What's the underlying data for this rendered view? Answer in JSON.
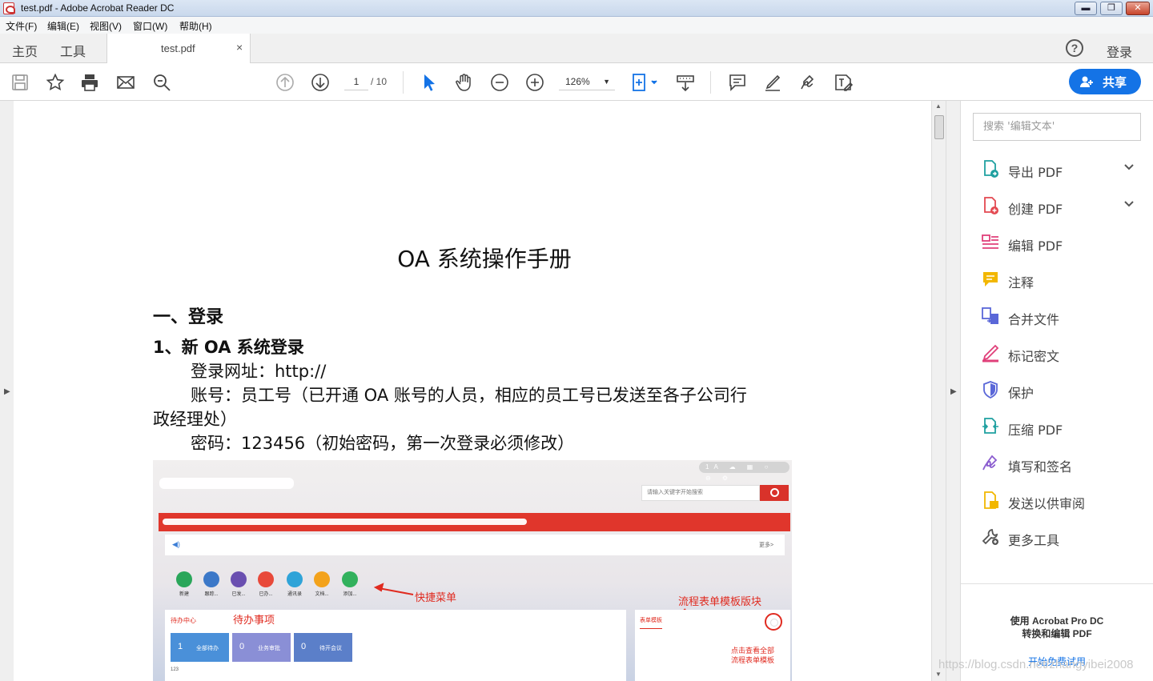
{
  "window": {
    "title": "test.pdf - Adobe Acrobat Reader DC",
    "minimize": "▬",
    "restore": "❐",
    "close": "✕"
  },
  "menubar": [
    "文件(F)",
    "编辑(E)",
    "视图(V)",
    "窗口(W)",
    "帮助(H)"
  ],
  "tabs": {
    "home": "主页",
    "tools": "工具",
    "document": "test.pdf",
    "close": "×",
    "help": "?",
    "login": "登录"
  },
  "toolbar": {
    "current_page": "1",
    "total_pages": "/ 10",
    "zoom": "126%",
    "zoom_dropdown": "▼",
    "share": "共享",
    "left_icons": [
      "save-icon",
      "bookmark-star-icon",
      "print-icon",
      "email-icon",
      "search-zoom-icon"
    ],
    "nav_icons": [
      "page-up-icon",
      "page-down-icon"
    ],
    "tool_icons": [
      "select-arrow-icon",
      "hand-icon",
      "zoom-out-icon",
      "zoom-in-icon",
      "fit-page-icon",
      "scroll-mode-icon",
      "comment-icon",
      "highlight-icon",
      "sign-icon",
      "edit-text-icon"
    ]
  },
  "document": {
    "title": "OA 系统操作手册",
    "heading1": "一、登录",
    "heading2": "1、新 OA 系统登录",
    "lines": [
      "登录网址：http://",
      "账号：员工号（已开通 OA 账号的人员，相应的员工号已发送至各子公司行",
      "政经理处）",
      "密码：123456（初始密码，第一次登录必须修改）"
    ],
    "screenshot": {
      "search_placeholder": "请输入关键字开始搜索",
      "top_icons": "1A ☁ ▦ ○ ⊖ ⚙",
      "notice_more": "更多>",
      "quick_menu": [
        {
          "label": "新建",
          "color": "#2aa65a"
        },
        {
          "label": "跟踪...",
          "color": "#3c78c8"
        },
        {
          "label": "已发...",
          "color": "#6a4fb0"
        },
        {
          "label": "已办...",
          "color": "#e8493a"
        },
        {
          "label": "通讯录",
          "color": "#2fa3d8"
        },
        {
          "label": "文档...",
          "color": "#f3a21c"
        },
        {
          "label": "添加...",
          "color": "#32b15d"
        }
      ],
      "annotations": {
        "quick_menu": "快捷菜单",
        "form_templates": "流程表单模板版块",
        "todo": "待办事项",
        "view_all_line1": "点击查看全部",
        "view_all_line2": "流程表单模板"
      },
      "todo_title": "待办中心",
      "template_title": "表单模板",
      "tiles": [
        {
          "count": "1",
          "label": "全部待办",
          "color": "#4a90d9"
        },
        {
          "count": "0",
          "label": "业务审批",
          "color": "#8a8fd6"
        },
        {
          "count": "0",
          "label": "待开会议",
          "color": "#5b7fc9"
        }
      ],
      "footer_number": "123"
    }
  },
  "right_panel": {
    "search_placeholder": "搜索 '编辑文本'",
    "tools": [
      {
        "label": "导出 PDF",
        "icon": "export-pdf-icon",
        "color": "#1fa0a0",
        "expandable": true
      },
      {
        "label": "创建 PDF",
        "icon": "create-pdf-icon",
        "color": "#e34850",
        "expandable": true
      },
      {
        "label": "编辑 PDF",
        "icon": "edit-pdf-icon",
        "color": "#e0407a",
        "expandable": false
      },
      {
        "label": "注释",
        "icon": "comment-icon",
        "color": "#f2b700",
        "expandable": false
      },
      {
        "label": "合并文件",
        "icon": "combine-files-icon",
        "color": "#5a67d8",
        "expandable": false
      },
      {
        "label": "标记密文",
        "icon": "redact-icon",
        "color": "#e0407a",
        "expandable": false
      },
      {
        "label": "保护",
        "icon": "protect-icon",
        "color": "#5a67d8",
        "expandable": false
      },
      {
        "label": "压缩 PDF",
        "icon": "compress-pdf-icon",
        "color": "#1fa0a0",
        "expandable": false
      },
      {
        "label": "填写和签名",
        "icon": "fill-sign-icon",
        "color": "#8a5ccf",
        "expandable": false
      },
      {
        "label": "发送以供审阅",
        "icon": "send-review-icon",
        "color": "#f2b700",
        "expandable": false
      },
      {
        "label": "更多工具",
        "icon": "more-tools-icon",
        "color": "#555555",
        "expandable": false
      }
    ],
    "promo_line1": "使用 Acrobat Pro DC",
    "promo_line2": "转换和编辑 PDF",
    "promo_trial": "开始免费试用"
  },
  "watermark": "https://blog.csdn.net/zhangyibei2008"
}
